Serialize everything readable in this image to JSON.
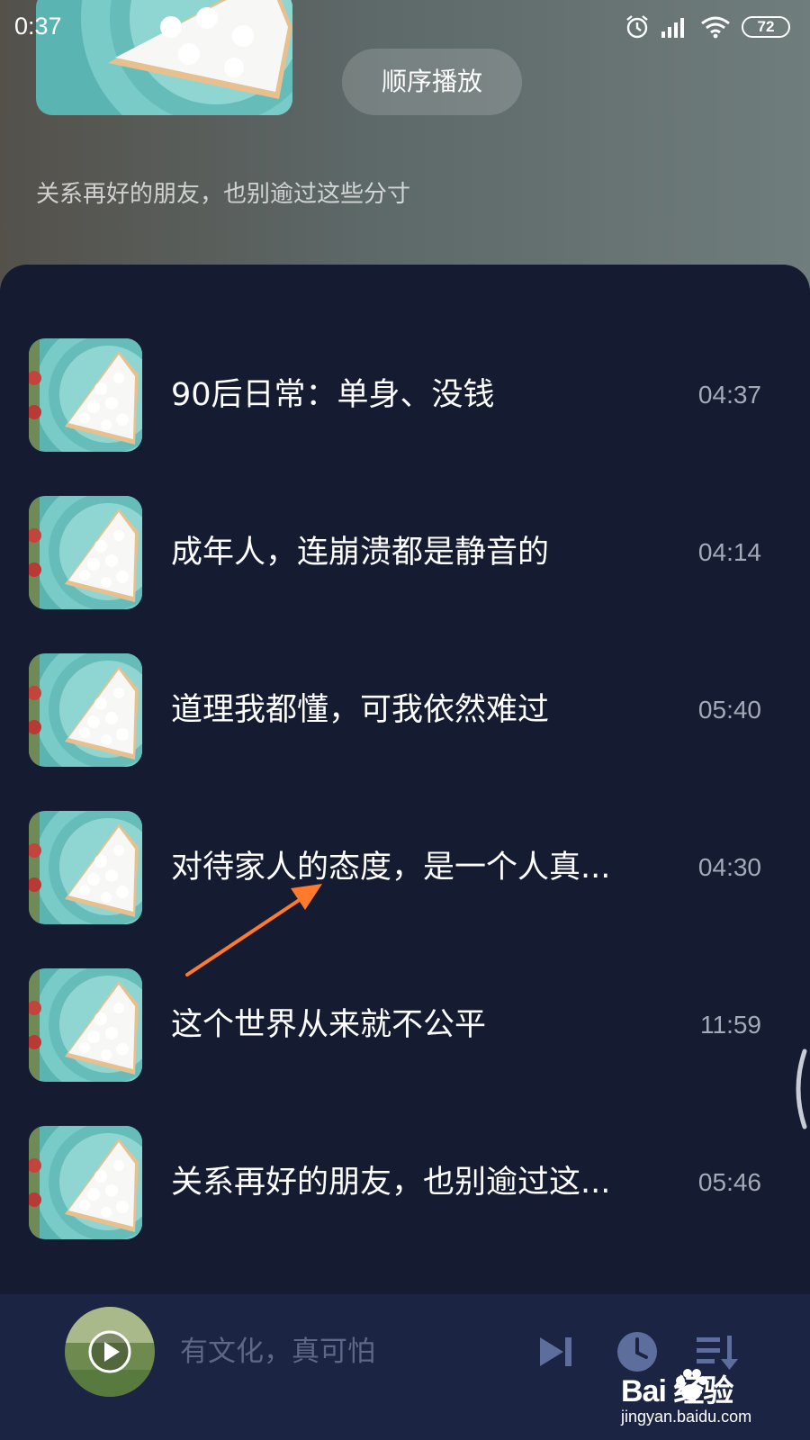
{
  "status_bar": {
    "time": "0:37",
    "battery": "72"
  },
  "header": {
    "play_mode_label": "顺序播放",
    "album_subtitle": "关系再好的朋友，也别逾过这些分寸"
  },
  "tracks": [
    {
      "title": "90后日常：单身、没钱",
      "duration": "04:37"
    },
    {
      "title": "成年人，连崩溃都是静音的",
      "duration": "04:14"
    },
    {
      "title": "道理我都懂，可我依然难过",
      "duration": "05:40"
    },
    {
      "title": "对待家人的态度，是一个人真...",
      "duration": "04:30"
    },
    {
      "title": "这个世界从来就不公平",
      "duration": "11:59"
    },
    {
      "title": "关系再好的朋友，也别逾过这...",
      "duration": "05:46"
    }
  ],
  "player": {
    "now_playing_title": "有文化，真可怕"
  },
  "watermark": {
    "logo": "Bai 经验",
    "url": "jingyan.baidu.com"
  },
  "colors": {
    "panel_bg": "#151b31",
    "player_bg": "#1b2443",
    "annotation_arrow": "#ff7a2a"
  },
  "icons": [
    "alarm-icon",
    "signal-icon",
    "wifi-icon",
    "battery-icon",
    "play-icon",
    "skip-next-icon",
    "timer-icon",
    "playlist-icon",
    "paw-icon"
  ]
}
